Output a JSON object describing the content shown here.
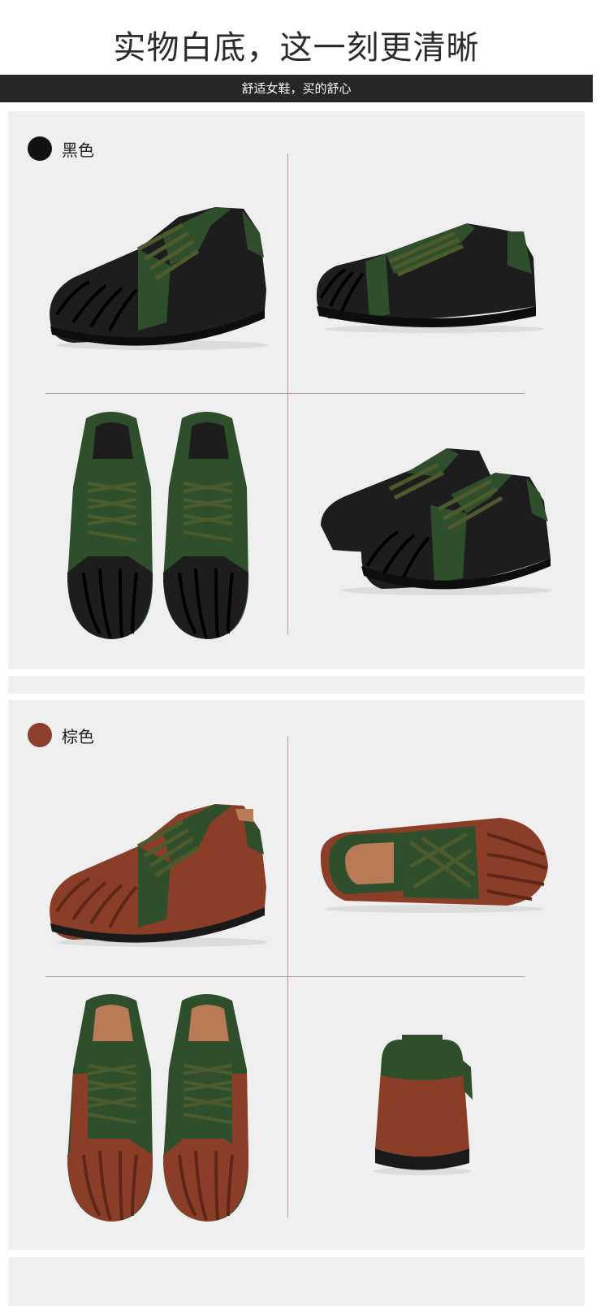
{
  "header": {
    "title": "实物白底，这一刻更清晰",
    "banner": "舒适女鞋，买的舒心"
  },
  "colors": {
    "panel_bg": "#efefef",
    "banner_bg": "#252628",
    "black_swatch": "#111111",
    "brown_swatch": "#8b3f2c",
    "leather_black": "#1d1d1d",
    "leather_green": "#2f4f2c",
    "leather_brown": "#8a3e28",
    "sole": "#1a1a1a"
  },
  "variants": [
    {
      "label": "黑色",
      "photos": [
        "black-shoe-side-left",
        "black-shoe-side-right",
        "black-shoe-top-pair",
        "black-shoe-angled-pair"
      ]
    },
    {
      "label": "棕色",
      "photos": [
        "brown-shoe-side-left",
        "brown-shoe-inner-side",
        "brown-shoe-top-pair",
        "brown-shoe-back"
      ]
    }
  ]
}
